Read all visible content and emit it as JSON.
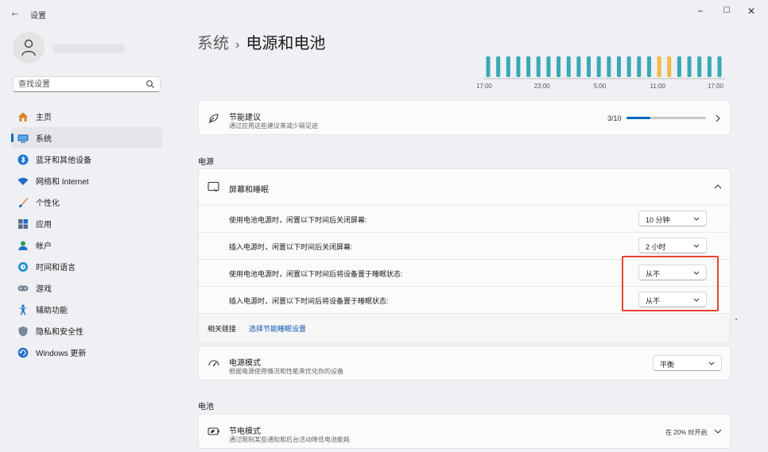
{
  "window": {
    "title": "设置",
    "back_glyph": "←",
    "minimize_glyph": "−",
    "maximize_glyph": "☐",
    "close_glyph": "✕"
  },
  "search": {
    "placeholder": "查找设置"
  },
  "sidebar": {
    "items": [
      {
        "label": "主页",
        "icon": "home-icon",
        "active": false
      },
      {
        "label": "系统",
        "icon": "system-icon",
        "active": true
      },
      {
        "label": "蓝牙和其他设备",
        "icon": "bluetooth-icon",
        "active": false
      },
      {
        "label": "网络和 Internet",
        "icon": "wifi-icon",
        "active": false
      },
      {
        "label": "个性化",
        "icon": "brush-icon",
        "active": false
      },
      {
        "label": "应用",
        "icon": "apps-icon",
        "active": false
      },
      {
        "label": "帐户",
        "icon": "account-icon",
        "active": false
      },
      {
        "label": "时间和语言",
        "icon": "globe-clock-icon",
        "active": false
      },
      {
        "label": "游戏",
        "icon": "gamepad-icon",
        "active": false
      },
      {
        "label": "辅助功能",
        "icon": "accessibility-icon",
        "active": false
      },
      {
        "label": "隐私和安全性",
        "icon": "shield-icon",
        "active": false
      },
      {
        "label": "Windows 更新",
        "icon": "update-icon",
        "active": false
      }
    ]
  },
  "breadcrumb": {
    "parent": "系统",
    "separator": "›",
    "current": "电源和电池"
  },
  "chart_data": {
    "type": "bar",
    "x_tick_labels": [
      "17:00",
      "23:00",
      "5:00",
      "11:00",
      "17:00"
    ],
    "series": [
      {
        "name": "",
        "color": "#3aa8b6",
        "bar_count": 24
      }
    ],
    "highlight": {
      "color": "#f2b84b",
      "bar_indices": [
        17,
        18
      ]
    },
    "values": [
      1,
      1,
      1,
      1,
      1,
      1,
      1,
      1,
      1,
      1,
      1,
      1,
      1,
      1,
      1,
      1,
      1,
      1,
      1,
      1,
      1,
      1,
      1,
      1
    ]
  },
  "energy_card": {
    "title": "节能建议",
    "subtitle": "通过应用这些建议来减少碳足迹",
    "count": "3/10",
    "progress": 0.3,
    "icon": "leaf-icon",
    "chevron": "chevron-right-icon"
  },
  "power_section": {
    "label": "电源",
    "screen_sleep": {
      "title": "屏幕和睡眠",
      "icon": "screen-sleep-icon",
      "rows": [
        {
          "label": "使用电池电源时，闲置以下时间后关闭屏幕:",
          "value": "10 分钟"
        },
        {
          "label": "插入电源时，闲置以下时间后关闭屏幕:",
          "value": "2 小时"
        },
        {
          "label": "使用电池电源时，闲置以下时间后将设备置于睡眠状态:",
          "value": "从不"
        },
        {
          "label": "插入电源时，闲置以下时间后将设备置于睡眠状态:",
          "value": "从不"
        }
      ],
      "related_label": "相关链接",
      "related_link": "选择节能睡眠设置"
    },
    "power_mode": {
      "title": "电源模式",
      "subtitle": "根据电源使用情况和性能来优化你的设备",
      "value": "平衡",
      "icon": "power-mode-icon"
    }
  },
  "battery_section": {
    "label": "电池",
    "saver": {
      "title": "节电模式",
      "subtitle": "通过限制某些通知和后台活动降低电池能耗",
      "status": "在 20% 时开启",
      "icon": "battery-saver-icon"
    }
  },
  "colors": {
    "accent": "#0067c0",
    "chart_bar": "#3aa8b6",
    "chart_highlight": "#f2b84b",
    "annotation_red": "#e8432f"
  }
}
